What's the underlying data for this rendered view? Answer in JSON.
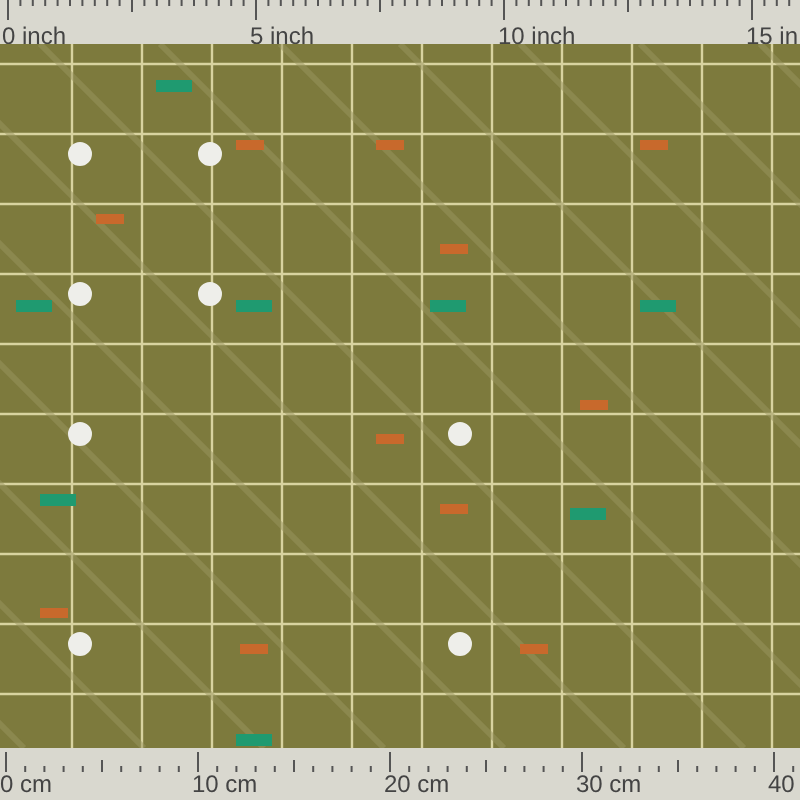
{
  "top_ruler": {
    "labels": [
      "0 inch",
      "5 inch",
      "10 inch",
      "15 in"
    ]
  },
  "bottom_ruler": {
    "labels": [
      "0 cm",
      "10 cm",
      "20 cm",
      "30 cm",
      "40"
    ]
  }
}
